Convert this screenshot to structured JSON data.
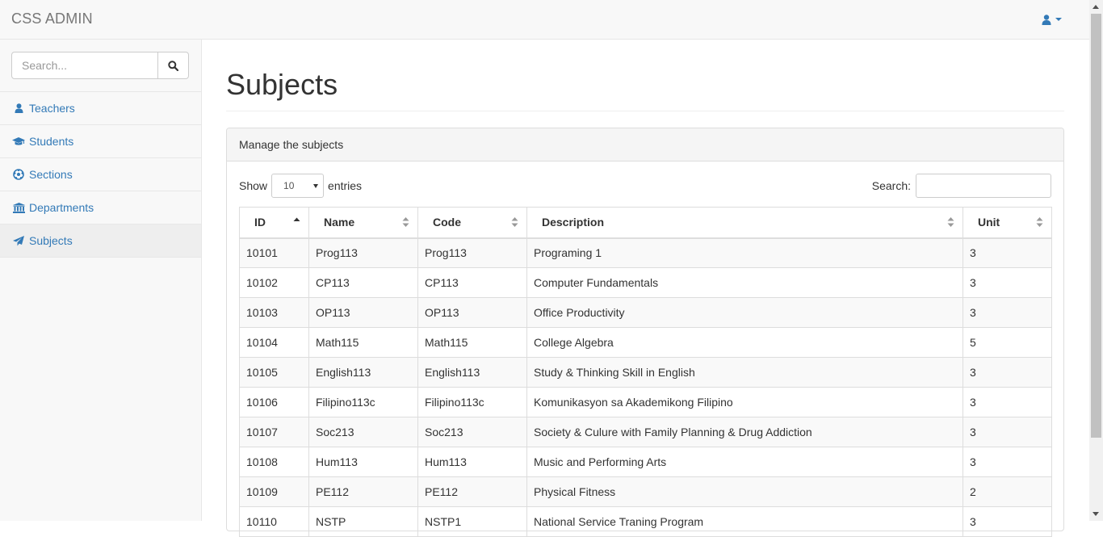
{
  "app": {
    "brand": "CSS ADMIN",
    "accent_color": "#337ab7",
    "user_menu_icon": "user-icon"
  },
  "sidebar": {
    "search_placeholder": "Search...",
    "search_icon": "search-icon",
    "items": [
      {
        "label": "Teachers",
        "icon": "user-icon",
        "active": false
      },
      {
        "label": "Students",
        "icon": "graduation-cap-icon",
        "active": false
      },
      {
        "label": "Sections",
        "icon": "soccer-ball-icon",
        "active": false
      },
      {
        "label": "Departments",
        "icon": "institution-icon",
        "active": false
      },
      {
        "label": "Subjects",
        "icon": "paper-plane-icon",
        "active": true
      }
    ]
  },
  "main": {
    "title": "Subjects",
    "panel_heading": "Manage the subjects",
    "show_label": "Show",
    "page_length": "10",
    "entries_label": "entries",
    "search_label": "Search:",
    "columns": [
      "ID",
      "Name",
      "Code",
      "Description",
      "Unit"
    ],
    "sorted_column": "ID",
    "sort_direction": "ascending",
    "rows": [
      [
        "10101",
        "Prog113",
        "Prog113",
        "Programing 1",
        "3"
      ],
      [
        "10102",
        "CP113",
        "CP113",
        "Computer Fundamentals",
        "3"
      ],
      [
        "10103",
        "OP113",
        "OP113",
        "Office Productivity",
        "3"
      ],
      [
        "10104",
        "Math115",
        "Math115",
        "College Algebra",
        "5"
      ],
      [
        "10105",
        "English113",
        "English113",
        "Study & Thinking Skill in English",
        "3"
      ],
      [
        "10106",
        "Filipino113c",
        "Filipino113c",
        "Komunikasyon sa Akademikong Filipino",
        "3"
      ],
      [
        "10107",
        "Soc213",
        "Soc213",
        "Society & Culure with Family Planning & Drug Addiction",
        "3"
      ],
      [
        "10108",
        "Hum113",
        "Hum113",
        "Music and Performing Arts",
        "3"
      ],
      [
        "10109",
        "PE112",
        "PE112",
        "Physical Fitness",
        "2"
      ],
      [
        "10110",
        "NSTP",
        "NSTP1",
        "National Service Traning Program",
        "3"
      ]
    ]
  }
}
